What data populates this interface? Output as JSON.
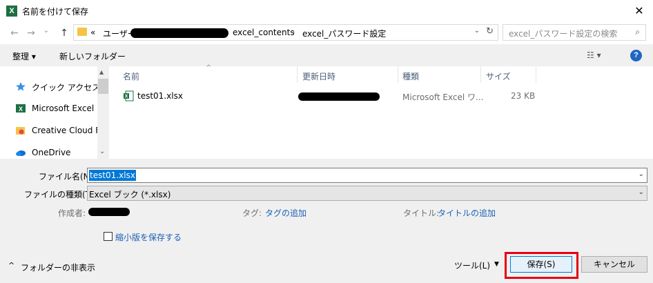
{
  "window": {
    "app_icon": "X",
    "title": "名前を付けて保存",
    "close_glyph": "✕"
  },
  "nav": {
    "back": "←",
    "forward": "→",
    "recent": "⌄",
    "up": "↑"
  },
  "address": {
    "overflow": "«",
    "crumbs": [
      "ユーザー",
      "excel_contents",
      "excel_パスワード設定"
    ],
    "separator": "›",
    "dropdown": "⌄",
    "refresh": "↻"
  },
  "search": {
    "placeholder": "excel_パスワード設定の検索",
    "icon": "⌕"
  },
  "toolbar": {
    "organize": "整理 ▾",
    "new_folder": "新しいフォルダー",
    "view": "☷ ▾",
    "help": "?"
  },
  "sidebar": {
    "items": [
      {
        "label": "クイック アクセス",
        "icon": "star-icon"
      },
      {
        "label": "Microsoft Excel",
        "icon": "excel-icon"
      },
      {
        "label": "Creative Cloud File",
        "icon": "creative-cloud-icon"
      },
      {
        "label": "OneDrive",
        "icon": "onedrive-icon"
      }
    ],
    "scroll_up": "▲",
    "scroll_down": "⌄"
  },
  "file_list": {
    "headers": [
      "名前",
      "更新日時",
      "種類",
      "サイズ"
    ],
    "sort_caret": "^",
    "rows": [
      {
        "name": "test01.xlsx",
        "type": "Microsoft Excel ワ...",
        "size": "23 KB"
      }
    ]
  },
  "form": {
    "filename_label": "ファイル名(N):",
    "filename_value": "test01.xlsx",
    "filetype_label": "ファイルの種類(T):",
    "filetype_value": "Excel ブック (*.xlsx)",
    "dd_arrow": "⌄",
    "author_label": "作成者:",
    "tags_label": "タグ:",
    "tags_link": "タグの追加",
    "title_label": "タイトル:",
    "title_link": "タイトルの追加",
    "thumbnail_label": "縮小版を保存する"
  },
  "footer": {
    "hide_folders": "フォルダーの非表示",
    "hide_caret": "^",
    "tools": "ツール(L)",
    "tools_caret": "▼",
    "save": "保存(S)",
    "cancel": "キャンセル"
  },
  "colors": {
    "excel_green": "#1d6f42",
    "selection_blue": "#0078d7",
    "link_blue": "#1a5fb4",
    "highlight_red": "#e60012",
    "panel_gray": "#f0f0f0"
  }
}
